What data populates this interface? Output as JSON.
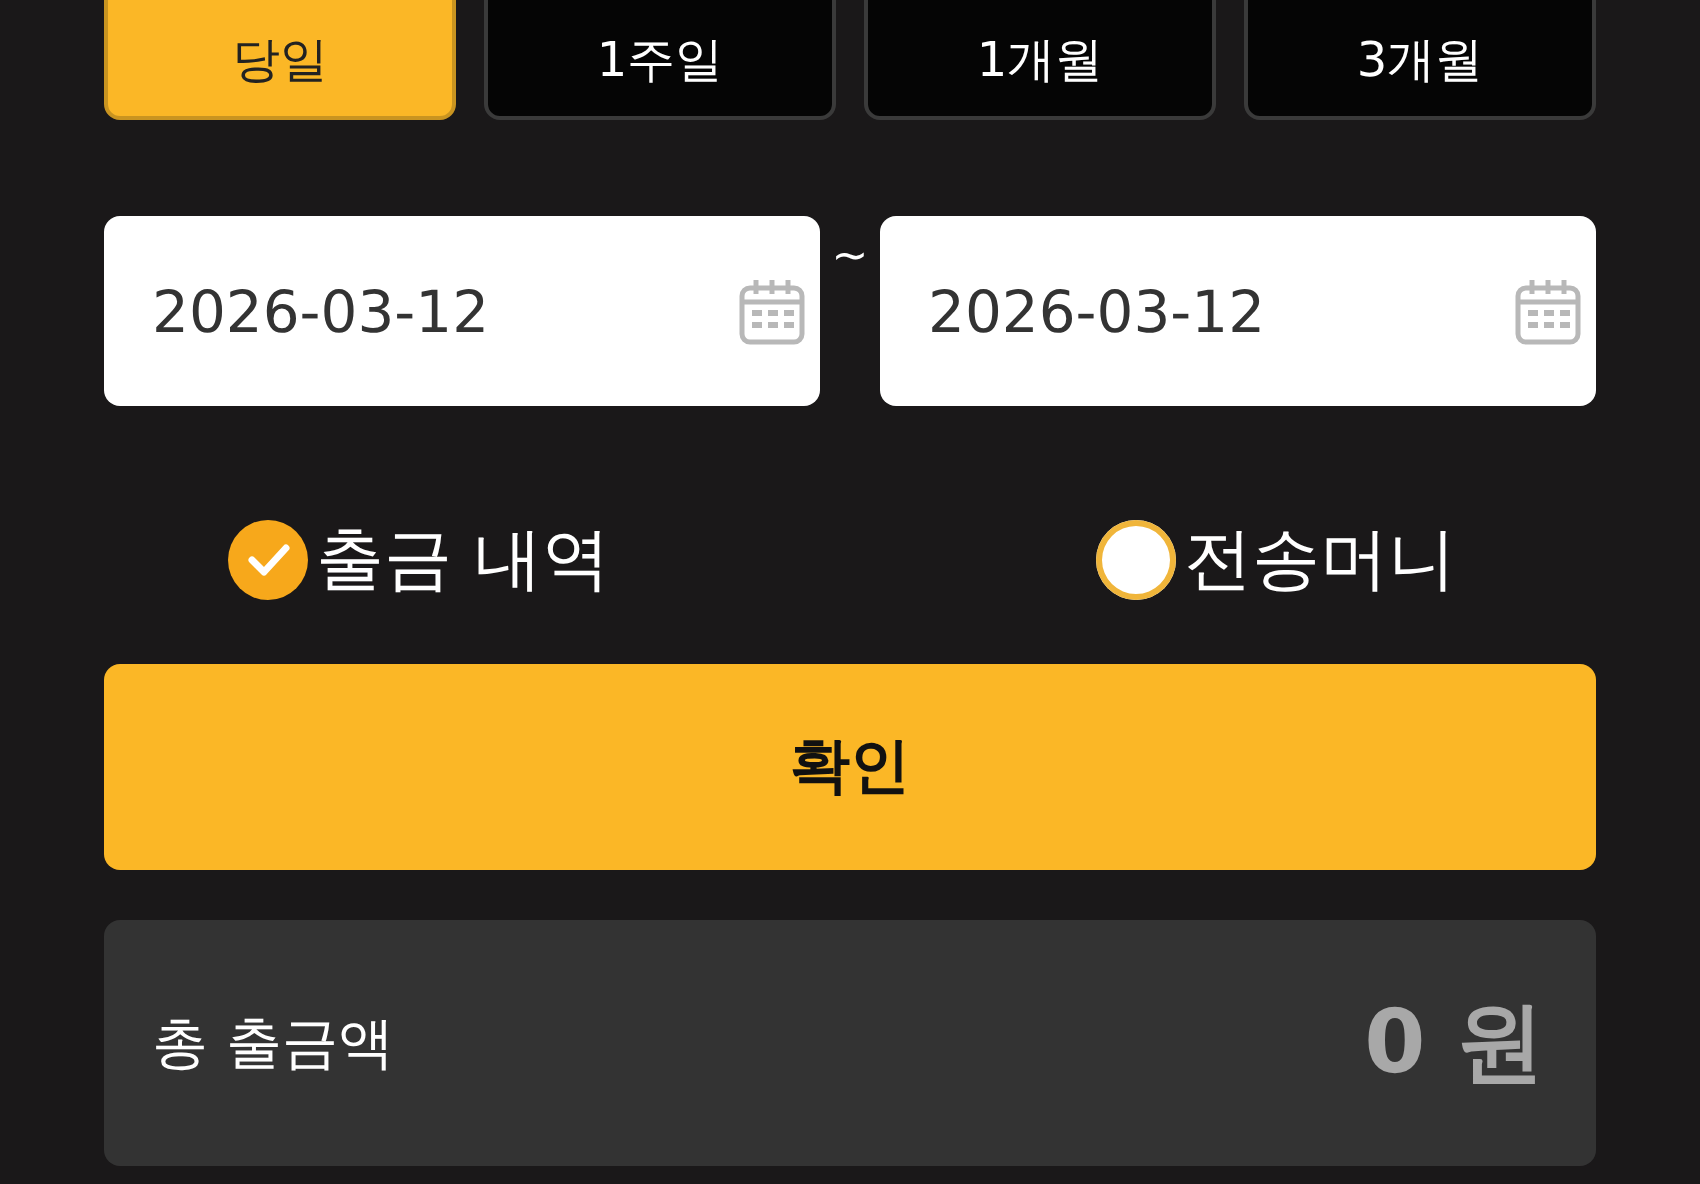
{
  "periods": [
    {
      "label": "당일",
      "selected": true
    },
    {
      "label": "1주일",
      "selected": false
    },
    {
      "label": "1개월",
      "selected": false
    },
    {
      "label": "3개월",
      "selected": false
    }
  ],
  "date_range": {
    "start": "2026-03-12",
    "separator": "~",
    "end": "2026-03-12"
  },
  "options": [
    {
      "label": "출금 내역",
      "selected": true
    },
    {
      "label": "전송머니",
      "selected": false
    }
  ],
  "confirm_button": "확인",
  "total": {
    "label": "총 출금액",
    "amount": "0",
    "unit": "원"
  }
}
